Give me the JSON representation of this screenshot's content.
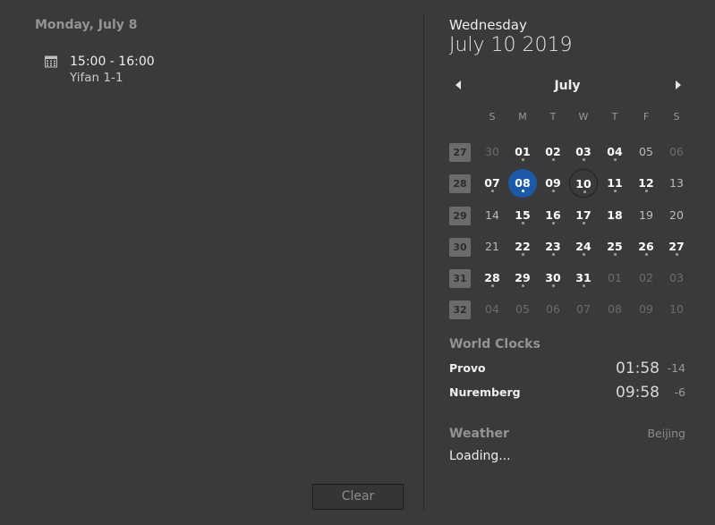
{
  "events_panel": {
    "day_heading": "Monday, July 8",
    "events": [
      {
        "time": "15:00 - 16:00",
        "summary": "Yifan 1-1",
        "icon": "calendar-icon"
      }
    ],
    "clear_label": "Clear"
  },
  "calendar": {
    "weekday": "Wednesday",
    "date": "July 10 2019",
    "month": "July",
    "day_headers": [
      "S",
      "M",
      "T",
      "W",
      "T",
      "F",
      "S"
    ],
    "weeks": [
      {
        "num": "27",
        "days": [
          {
            "d": "30",
            "o": true
          },
          {
            "d": "01",
            "e": true
          },
          {
            "d": "02",
            "e": true
          },
          {
            "d": "03",
            "e": true
          },
          {
            "d": "04",
            "e": true
          },
          {
            "d": "05"
          },
          {
            "d": "06",
            "o": true
          }
        ]
      },
      {
        "num": "28",
        "days": [
          {
            "d": "07",
            "e": true
          },
          {
            "d": "08",
            "e": true,
            "sel": true
          },
          {
            "d": "09",
            "e": true
          },
          {
            "d": "10",
            "e": true,
            "today": true
          },
          {
            "d": "11",
            "e": true
          },
          {
            "d": "12",
            "e": true
          },
          {
            "d": "13"
          }
        ]
      },
      {
        "num": "29",
        "days": [
          {
            "d": "14"
          },
          {
            "d": "15",
            "e": true
          },
          {
            "d": "16",
            "e": true
          },
          {
            "d": "17",
            "e": true
          },
          {
            "d": "18"
          },
          {
            "d": "19"
          },
          {
            "d": "20"
          }
        ]
      },
      {
        "num": "30",
        "days": [
          {
            "d": "21"
          },
          {
            "d": "22",
            "e": true
          },
          {
            "d": "23",
            "e": true
          },
          {
            "d": "24",
            "e": true
          },
          {
            "d": "25",
            "e": true
          },
          {
            "d": "26",
            "e": true
          },
          {
            "d": "27",
            "e": true
          }
        ]
      },
      {
        "num": "31",
        "days": [
          {
            "d": "28",
            "e": true
          },
          {
            "d": "29",
            "e": true
          },
          {
            "d": "30",
            "e": true
          },
          {
            "d": "31",
            "e": true
          },
          {
            "d": "01",
            "o": true
          },
          {
            "d": "02",
            "o": true
          },
          {
            "d": "03",
            "o": true
          }
        ]
      },
      {
        "num": "32",
        "days": [
          {
            "d": "04",
            "o": true
          },
          {
            "d": "05",
            "o": true
          },
          {
            "d": "06",
            "o": true
          },
          {
            "d": "07",
            "o": true
          },
          {
            "d": "08",
            "o": true
          },
          {
            "d": "09",
            "o": true
          },
          {
            "d": "10",
            "o": true
          }
        ]
      }
    ],
    "colors": {
      "selected": "#1c59a8",
      "background": "#3a3a3d"
    }
  },
  "world_clocks": {
    "title": "World Clocks",
    "clocks": [
      {
        "name": "Provo",
        "time": "01:58",
        "offset": "-14"
      },
      {
        "name": "Nuremberg",
        "time": "09:58",
        "offset": "-6"
      }
    ]
  },
  "weather": {
    "title": "Weather",
    "location": "Beijing",
    "status": "Loading..."
  }
}
